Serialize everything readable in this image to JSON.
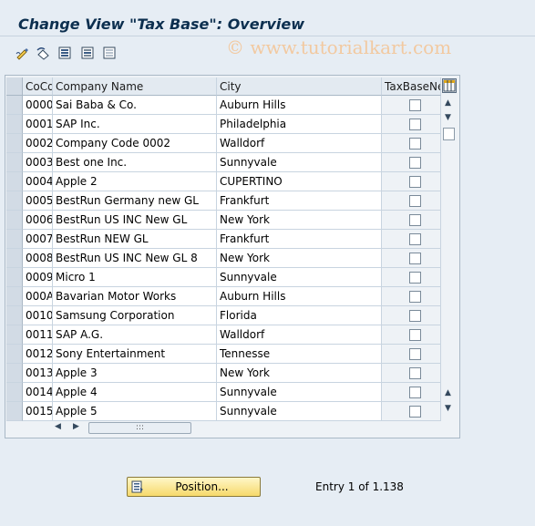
{
  "window": {
    "title": "Change View \"Tax Base\": Overview",
    "watermark": "© www.tutorialkart.com"
  },
  "toolbar": {
    "icons": [
      "edit-icon",
      "undo-changes-icon",
      "select-all-icon",
      "select-block-icon",
      "deselect-all-icon"
    ]
  },
  "table": {
    "columns": [
      "CoCd",
      "Company Name",
      "City",
      "TaxBaseNet"
    ],
    "rows": [
      {
        "cocd": "0000",
        "name": "Sai Baba & Co.",
        "city": "Auburn Hills"
      },
      {
        "cocd": "0001",
        "name": "SAP Inc.",
        "city": "Philadelphia"
      },
      {
        "cocd": "0002",
        "name": "Company Code 0002",
        "city": "Walldorf"
      },
      {
        "cocd": "0003",
        "name": "Best one Inc.",
        "city": "Sunnyvale"
      },
      {
        "cocd": "0004",
        "name": "Apple 2",
        "city": "CUPERTINO"
      },
      {
        "cocd": "0005",
        "name": "BestRun Germany new GL",
        "city": "Frankfurt"
      },
      {
        "cocd": "0006",
        "name": "BestRun US INC New GL",
        "city": "New York"
      },
      {
        "cocd": "0007",
        "name": "BestRun NEW GL",
        "city": "Frankfurt"
      },
      {
        "cocd": "0008",
        "name": "BestRun US INC New GL 8",
        "city": "New York"
      },
      {
        "cocd": "0009",
        "name": "Micro 1",
        "city": "Sunnyvale"
      },
      {
        "cocd": "000A",
        "name": "Bavarian Motor Works",
        "city": "Auburn Hills"
      },
      {
        "cocd": "0010",
        "name": "Samsung Corporation",
        "city": "Florida"
      },
      {
        "cocd": "0011",
        "name": "SAP A.G.",
        "city": "Walldorf"
      },
      {
        "cocd": "0012",
        "name": "Sony Entertainment",
        "city": "Tennesse"
      },
      {
        "cocd": "0013",
        "name": "Apple 3",
        "city": "New York"
      },
      {
        "cocd": "0014",
        "name": "Apple 4",
        "city": "Sunnyvale"
      },
      {
        "cocd": "0015",
        "name": "Apple 5",
        "city": "Sunnyvale"
      }
    ]
  },
  "footer": {
    "position_label": "Position...",
    "entry_text": "Entry 1 of 1.138"
  },
  "colors": {
    "title": "#0c2f4f",
    "background": "#e6edf4",
    "button": "#f6d96b"
  }
}
